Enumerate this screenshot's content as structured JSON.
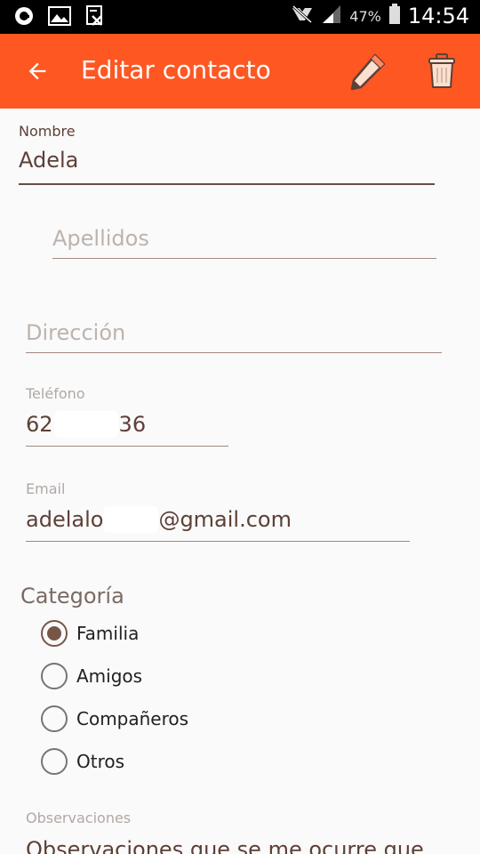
{
  "status_bar": {
    "battery_percent": "47%",
    "time": "14:54"
  },
  "app_bar": {
    "title": "Editar contacto"
  },
  "form": {
    "nombre": {
      "label": "Nombre",
      "value": "Adela"
    },
    "apellidos": {
      "placeholder": "Apellidos"
    },
    "direccion": {
      "placeholder": "Dirección"
    },
    "telefono": {
      "label": "Teléfono",
      "value_start": "62",
      "value_end": "36"
    },
    "email": {
      "label": "Email",
      "value_start": "adelalo",
      "value_end": "@gmail.com"
    },
    "categoria": {
      "title": "Categoría",
      "options": [
        "Familia",
        "Amigos",
        "Compañeros",
        "Otros"
      ],
      "selected": "Familia"
    },
    "observaciones": {
      "label": "Observaciones",
      "value": "Observaciones que se me ocurre que"
    }
  },
  "colors": {
    "app_bar": "#ff5722",
    "accent": "#795548",
    "status_bar": "#000000"
  }
}
